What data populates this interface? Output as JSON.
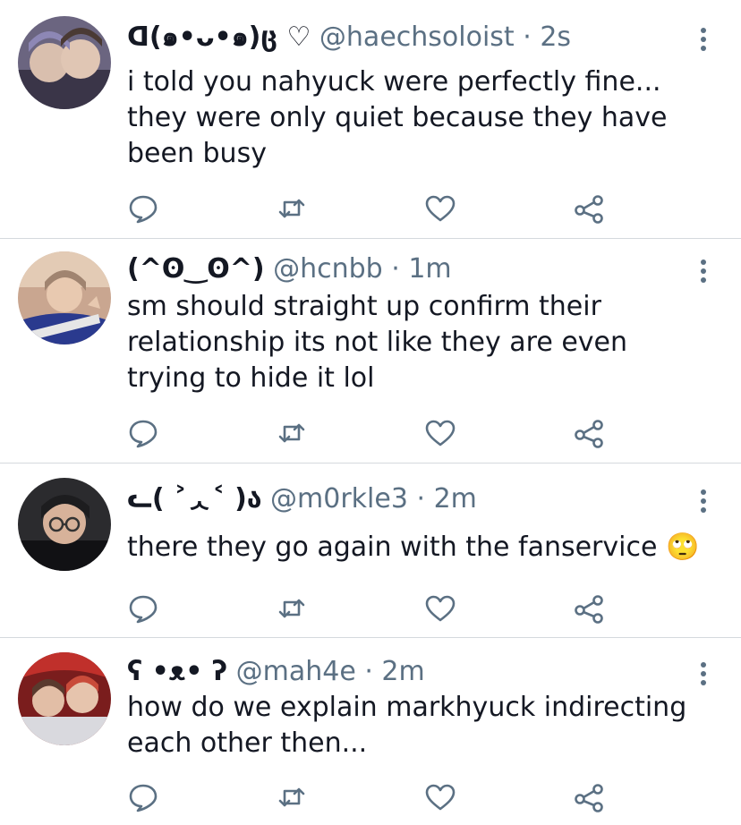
{
  "tweets": [
    {
      "name": "ᗡ(๑•ᴗ•๑)ც ♡",
      "handle": "@haechsoloist",
      "dot": "·",
      "time": "2s",
      "text": "i told you nahyuck were perfectly fine... they were only quiet because they have been busy"
    },
    {
      "name": "(^ʘ‿ʘ^)",
      "handle": "@hcnbb",
      "dot": "·",
      "time": "1m",
      "text": "sm should straight up confirm their relationship its not like they are even trying to hide it lol"
    },
    {
      "name": "ᓚ( ˃ᆺ˂ )ა",
      "handle": "@m0rkle3",
      "dot": "·",
      "time": "2m",
      "text": "there they go again with the fanservice 🙄"
    },
    {
      "name": "ʕ •ᴥ• ʔ",
      "handle": "@mah4e",
      "dot": "·",
      "time": "2m",
      "text": "how do we explain markhyuck indirecting each other then..."
    }
  ],
  "icons": {
    "reply": "reply-icon",
    "retweet": "retweet-icon",
    "like": "heart-icon",
    "share": "share-icon",
    "more": "more-icon"
  },
  "colors": {
    "icon": "#5b7083",
    "text": "#141823",
    "divider": "#d5d9dd"
  }
}
